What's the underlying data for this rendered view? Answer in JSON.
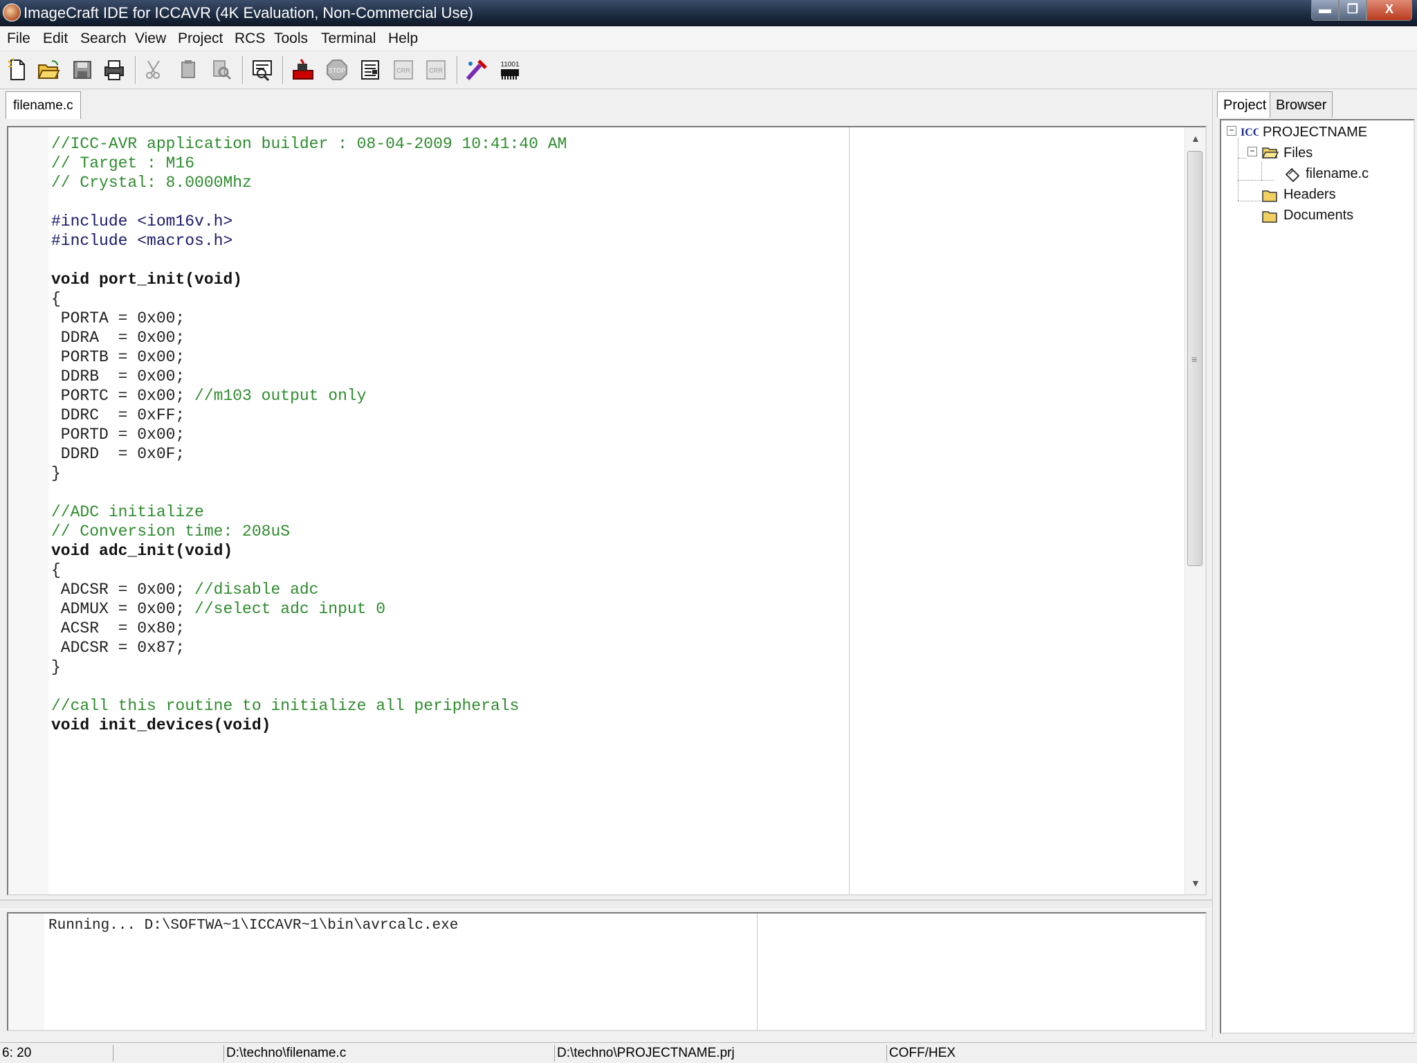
{
  "window": {
    "title": "ImageCraft IDE for ICCAVR (4K Evaluation, Non-Commercial Use)",
    "minimize_glyph": "▬",
    "maximize_glyph": "❐",
    "close_glyph": "X"
  },
  "menu": [
    "File",
    "Edit",
    "Search",
    "View",
    "Project",
    "RCS",
    "Tools",
    "Terminal",
    "Help"
  ],
  "toolbar": {
    "icons": [
      "new-file-icon",
      "open-folder-icon",
      "save-icon",
      "print-icon",
      "cut-icon",
      "copy-icon",
      "find-icon",
      "view-icon",
      "build-icon",
      "stop-icon",
      "compile-icon",
      "disabled-cr-icon",
      "disabled-cr2-icon",
      "programmer-icon",
      "binary-icon"
    ],
    "binary_label": "11001"
  },
  "editor": {
    "tab_label": "filename.c",
    "lines": [
      {
        "t": "//ICC-AVR application builder : 08-04-2009 10:41:40 AM",
        "c": "cmt"
      },
      {
        "t": "// Target : M16",
        "c": "cmt"
      },
      {
        "t": "// Crystal: 8.0000Mhz",
        "c": "cmt"
      },
      {
        "t": "",
        "c": ""
      },
      {
        "t": "#include <iom16v.h>",
        "c": "pp"
      },
      {
        "t": "#include <macros.h>",
        "c": "pp"
      },
      {
        "t": "",
        "c": ""
      },
      {
        "t": "void port_init(void)",
        "c": "kw"
      },
      {
        "t": "{",
        "c": ""
      },
      {
        "t": " PORTA = 0x00;",
        "c": ""
      },
      {
        "t": " DDRA  = 0x00;",
        "c": ""
      },
      {
        "t": " PORTB = 0x00;",
        "c": ""
      },
      {
        "t": " DDRB  = 0x00;",
        "c": ""
      },
      {
        "t": " PORTC = 0x00; ",
        "c": "",
        "cmt": "//m103 output only"
      },
      {
        "t": " DDRC  = 0xFF;",
        "c": ""
      },
      {
        "t": " PORTD = 0x00;",
        "c": ""
      },
      {
        "t": " DDRD  = 0x0F;",
        "c": ""
      },
      {
        "t": "}",
        "c": ""
      },
      {
        "t": "",
        "c": ""
      },
      {
        "t": "//ADC initialize",
        "c": "cmt"
      },
      {
        "t": "// Conversion time: 208uS",
        "c": "cmt"
      },
      {
        "t": "void adc_init(void)",
        "c": "kw"
      },
      {
        "t": "{",
        "c": ""
      },
      {
        "t": " ADCSR = 0x00; ",
        "c": "",
        "cmt": "//disable adc"
      },
      {
        "t": " ADMUX = 0x00; ",
        "c": "",
        "cmt": "//select adc input 0"
      },
      {
        "t": " ACSR  = 0x80;",
        "c": ""
      },
      {
        "t": " ADCSR = 0x87;",
        "c": ""
      },
      {
        "t": "}",
        "c": ""
      },
      {
        "t": "",
        "c": ""
      },
      {
        "t": "//call this routine to initialize all peripherals",
        "c": "cmt"
      },
      {
        "t": "void init_devices(void)",
        "c": "kw"
      }
    ]
  },
  "output": {
    "text": "Running... D:\\SOFTWA~1\\ICCAVR~1\\bin\\avrcalc.exe"
  },
  "side": {
    "tab_project": "Project",
    "tab_browser": "Browser",
    "tree": {
      "root": "PROJECTNAME",
      "files": "Files",
      "file": "filename.c",
      "headers": "Headers",
      "documents": "Documents"
    }
  },
  "status": {
    "position": "6: 20",
    "blank": "",
    "file_path": "D:\\techno\\filename.c",
    "project_path": "D:\\techno\\PROJECTNAME.prj",
    "output_format": "COFF/HEX"
  },
  "colors": {
    "comment": "#2e8b2e",
    "titlebar": "#1c2a40"
  }
}
